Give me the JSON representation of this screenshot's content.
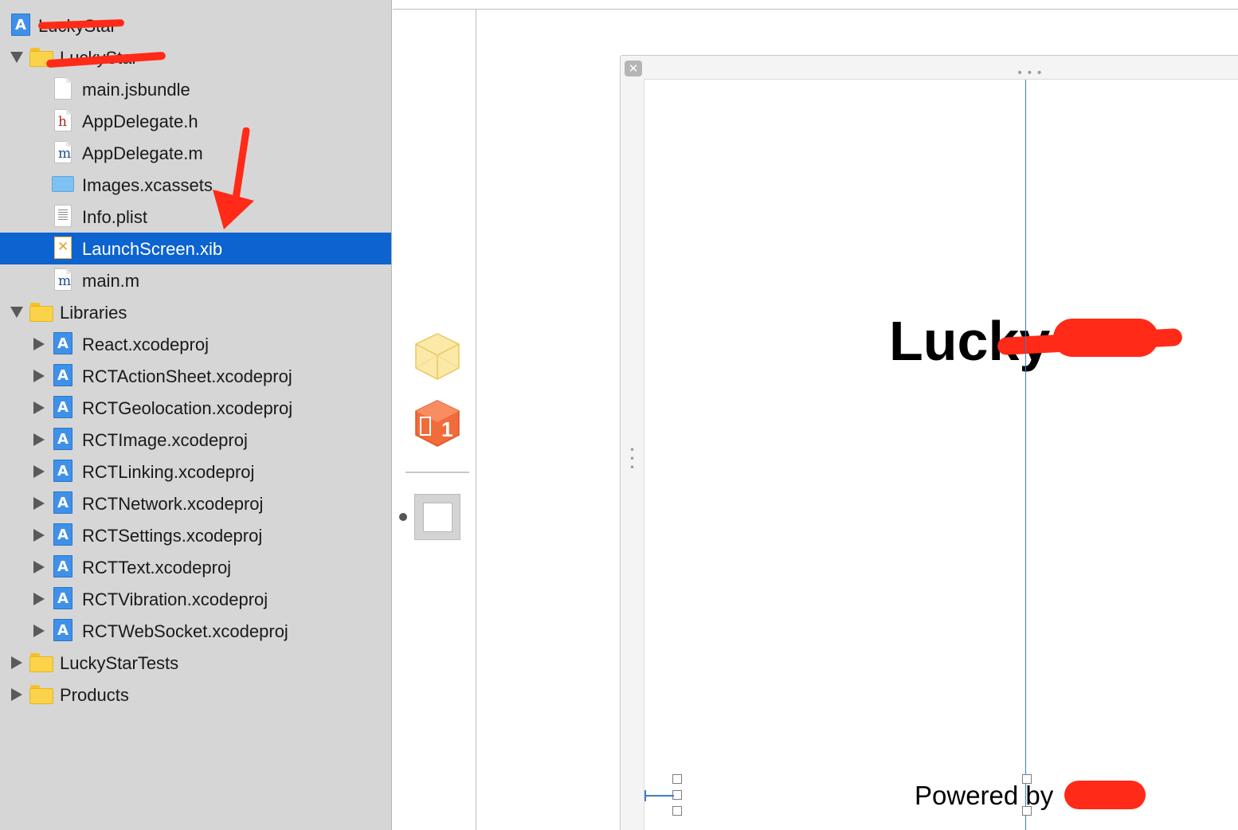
{
  "navigator": {
    "items": [
      {
        "label": "LuckyStar",
        "icon": "xcode-project-icon",
        "level": 0,
        "redacted": true
      },
      {
        "label": "LuckyStar",
        "icon": "folder-icon",
        "level": 0,
        "disclosure": "open",
        "redacted": true
      },
      {
        "label": "main.jsbundle",
        "icon": "file-icon",
        "level": 1
      },
      {
        "label": "AppDelegate.h",
        "icon": "header-file-icon",
        "glyph": "h",
        "level": 1
      },
      {
        "label": "AppDelegate.m",
        "icon": "source-file-icon",
        "glyph": "m",
        "level": 1
      },
      {
        "label": "Images.xcassets",
        "icon": "asset-catalog-icon",
        "level": 1
      },
      {
        "label": "Info.plist",
        "icon": "plist-file-icon",
        "level": 1
      },
      {
        "label": "LaunchScreen.xib",
        "icon": "xib-file-icon",
        "level": 1,
        "selected": true
      },
      {
        "label": "main.m",
        "icon": "source-file-icon",
        "glyph": "m",
        "level": 1
      },
      {
        "label": "Libraries",
        "icon": "folder-icon",
        "level": 0,
        "disclosure": "open"
      },
      {
        "label": "React.xcodeproj",
        "icon": "xcode-project-icon",
        "level": 1,
        "disclosure": "closed"
      },
      {
        "label": "RCTActionSheet.xcodeproj",
        "icon": "xcode-project-icon",
        "level": 1,
        "disclosure": "closed"
      },
      {
        "label": "RCTGeolocation.xcodeproj",
        "icon": "xcode-project-icon",
        "level": 1,
        "disclosure": "closed"
      },
      {
        "label": "RCTImage.xcodeproj",
        "icon": "xcode-project-icon",
        "level": 1,
        "disclosure": "closed"
      },
      {
        "label": "RCTLinking.xcodeproj",
        "icon": "xcode-project-icon",
        "level": 1,
        "disclosure": "closed"
      },
      {
        "label": "RCTNetwork.xcodeproj",
        "icon": "xcode-project-icon",
        "level": 1,
        "disclosure": "closed"
      },
      {
        "label": "RCTSettings.xcodeproj",
        "icon": "xcode-project-icon",
        "level": 1,
        "disclosure": "closed"
      },
      {
        "label": "RCTText.xcodeproj",
        "icon": "xcode-project-icon",
        "level": 1,
        "disclosure": "closed"
      },
      {
        "label": "RCTVibration.xcodeproj",
        "icon": "xcode-project-icon",
        "level": 1,
        "disclosure": "closed"
      },
      {
        "label": "RCTWebSocket.xcodeproj",
        "icon": "xcode-project-icon",
        "level": 1,
        "disclosure": "closed"
      },
      {
        "label": "LuckyStarTests",
        "icon": "folder-icon",
        "level": 0,
        "disclosure": "closed"
      },
      {
        "label": "Products",
        "icon": "folder-icon",
        "level": 0,
        "disclosure": "closed"
      }
    ]
  },
  "dock": {
    "placeholder_icon": "placeholder-cube-icon",
    "first_responder_icon": "first-responder-cube-icon",
    "first_responder_badge": "1",
    "view_icon": "view-icon"
  },
  "canvas": {
    "close_glyph": "✕",
    "title_text": "Lucky",
    "powered_text": "Powered by"
  },
  "colors": {
    "navigator_bg": "#d6d6d6",
    "selection": "#0d63cf",
    "guide_line": "#3d7cc9",
    "annotation_red": "#ff2a17"
  }
}
